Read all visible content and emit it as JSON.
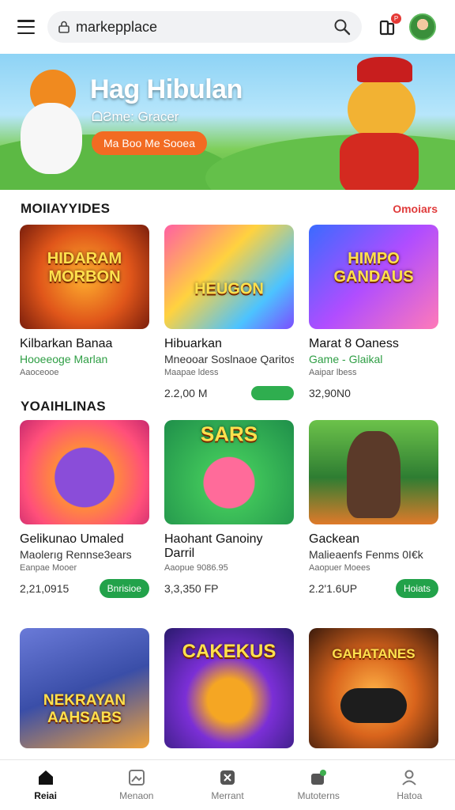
{
  "search": {
    "value": "markepplace"
  },
  "notifications": {
    "badge": "P"
  },
  "banner": {
    "title": "Hag Hibulan",
    "subtitle": "ᗝƧme: Gracer",
    "button": "Ma Boo Me Sooea"
  },
  "sections": [
    {
      "title": "MOIIAYYIDES",
      "see_all": "Omoiars",
      "items": [
        {
          "thumb_text": "HIDARAM MORBON",
          "title": "Kilbarkan Banaa",
          "subtitle": "Hooeeoge Marlan",
          "meta": "Aaoceooe",
          "price": ""
        },
        {
          "thumb_text": "HEUGON",
          "title": "Hibuarkan",
          "subtitle": "Mneooar Soslnaoe Qaritos",
          "meta": "Maapae ldess",
          "price": "2.2,00 M"
        },
        {
          "thumb_text": "HIMPO GANDAUS",
          "title": "Marat 8 Oaness",
          "subtitle": "Game - Glaikal",
          "meta": "Aaipar lbess",
          "price": "32,90N0"
        }
      ]
    },
    {
      "title": "YOAIHLINAS",
      "see_all": "",
      "items": [
        {
          "thumb_text": "",
          "title": "Gelikunao Umaled",
          "subtitle": "Maolerıg Rennse3ears",
          "meta": "Eanpae Mooer",
          "price": "2,21,0915",
          "button": "Bnrisioe"
        },
        {
          "thumb_text": "SARS",
          "title": "Haohant Ganoiny Darril",
          "subtitle": "",
          "meta": "Aaopue 9086.95",
          "price": "3,3,350 FP",
          "button": ""
        },
        {
          "thumb_text": "",
          "title": "Gackean",
          "subtitle": "Malieaenfs Fenms 0I€k",
          "meta": "Aaopuer Moees",
          "price": "2.2'1.6UP",
          "button": "Hoiats"
        }
      ]
    },
    {
      "title": "",
      "items": [
        {
          "thumb_text": "NEKRAYAN AAHSABS"
        },
        {
          "thumb_text": "CAKEKUS"
        },
        {
          "thumb_text": "GAHATANES"
        }
      ]
    }
  ],
  "bottom_nav": [
    {
      "label": "Reiai",
      "icon": "home-icon",
      "active": true
    },
    {
      "label": "Menaon",
      "icon": "image-icon",
      "active": false
    },
    {
      "label": "Merrant",
      "icon": "store-icon",
      "active": false
    },
    {
      "label": "Mutoterns",
      "icon": "cart-icon",
      "active": false
    },
    {
      "label": "Hatoa",
      "icon": "user-icon",
      "active": false
    }
  ]
}
